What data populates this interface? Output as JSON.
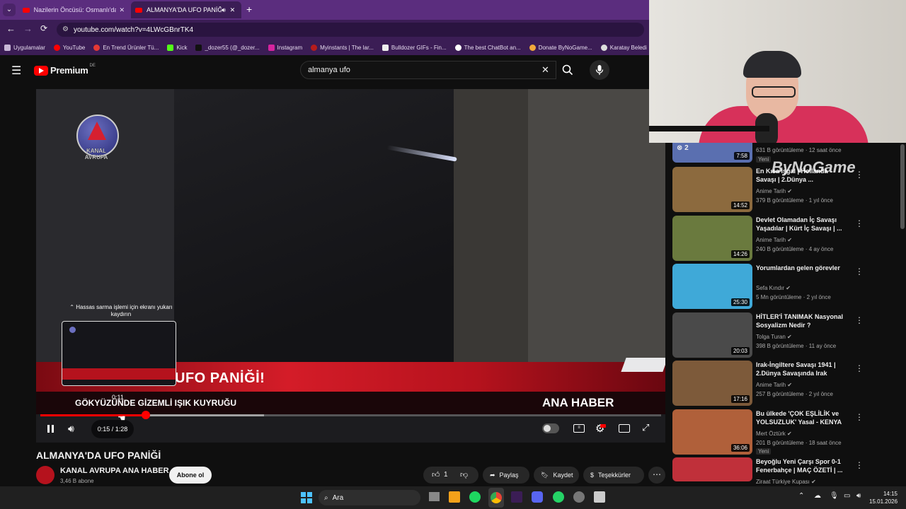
{
  "browser": {
    "tabs": [
      {
        "label": "Nazilerin Öncüsü: Osmanlı'da Y"
      },
      {
        "label": "ALMANYA'DA UFO PANİĞİ"
      }
    ],
    "url": "youtube.com/watch?v=4LWcGBnrTK4",
    "bookmarks": [
      "Uygulamalar",
      "YouTube",
      "En Trend Ürünler Tü...",
      "Kick",
      "_dozer55 (@_dozer...",
      "Instagram",
      "Myinstants | The lar...",
      "Bulldozer GIFs - Fin...",
      "The best ChatBot an...",
      "Donate ByNoGame...",
      "Karatay Beledi"
    ]
  },
  "youtube": {
    "logo_text": "Premium",
    "region": "DE",
    "search_value": "almanya ufo",
    "video": {
      "channel_logo_text": [
        "KANAL",
        "AVRUPA"
      ],
      "banner_title": "UFO PANİĞİ!",
      "banner_subtitle": "GÖKYÜZÜNDE GİZEMLİ IŞIK KUYRUĞU",
      "banner_brand": "ANA HABER",
      "hint": "Hassas sarma işlemi için ekranı yukarı kaydırın",
      "preview_time": "0:11",
      "time": "0:15 / 1:28",
      "progress": 0.17,
      "buffered": 0.36
    },
    "title": "ALMANYA'DA UFO PANİĞİ",
    "channel": "KANAL AVRUPA ANA HABER",
    "subscribers": "3,46 B abone",
    "subscribe": "Abone ol",
    "likes": "1",
    "share": "Paylaş",
    "save": "Kaydet",
    "thanks": "Teşekkürler"
  },
  "recommendations": [
    {
      "title": "",
      "channel": "",
      "meta": "631 B görüntüleme · 12 saat önce",
      "badge": "Yeni",
      "duration": "7:58",
      "thumb_color": "#5a6fb0"
    },
    {
      "title": "En Kısa İşgal | Hollanda Savaşı | 2.Dünya ...",
      "channel": "Anime Tarih",
      "meta": "379 B görüntüleme · 1 yıl önce",
      "duration": "14:52",
      "thumb_color": "#8c6a3e"
    },
    {
      "title": "Devlet Olamadan İç Savaşı Yaşadılar | Kürt İç Savaşı | ...",
      "channel": "Anime Tarih",
      "meta": "240 B görüntüleme · 4 ay önce",
      "duration": "14:26",
      "thumb_color": "#6a7a3e"
    },
    {
      "title": "Yorumlardan gelen görevler",
      "channel": "Sefa Kındır",
      "meta": "5 Mn görüntüleme · 2 yıl önce",
      "duration": "25:30",
      "thumb_color": "#3fa9d8"
    },
    {
      "title": "HİTLER'İ TANIMAK Nasyonal Sosyalizm Nedir ?",
      "channel": "Tolga Turan",
      "meta": "398 B görüntüleme · 11 ay önce",
      "duration": "20:03",
      "thumb_color": "#4a4a4a"
    },
    {
      "title": "Irak-İngiltere Savaşı 1941 | 2.Dünya Savaşında Irak",
      "channel": "Anime Tarih",
      "meta": "257 B görüntüleme · 2 yıl önce",
      "duration": "17:16",
      "thumb_color": "#7d5a3a"
    },
    {
      "title": "Bu ülkede 'ÇOK EŞLİLİK ve YOLSUZLUK' Yasal - KENYA",
      "channel": "Mert Öztürk",
      "meta": "201 B görüntüleme · 18 saat önce",
      "badge": "Yeni",
      "duration": "36:06",
      "thumb_color": "#b0603a"
    },
    {
      "title": "Beyoğlu Yeni Çarşı Spor 0-1 Fenerbahçe | MAÇ ÖZETİ | ...",
      "channel": "Ziraat Türkiye Kupası",
      "meta": "",
      "duration": "",
      "thumb_color": "#c0303a"
    }
  ],
  "overlay": {
    "watermark": "ByNoGame"
  },
  "taskbar": {
    "search": "Ara",
    "time": "14:15",
    "date": "15.01.2026"
  }
}
